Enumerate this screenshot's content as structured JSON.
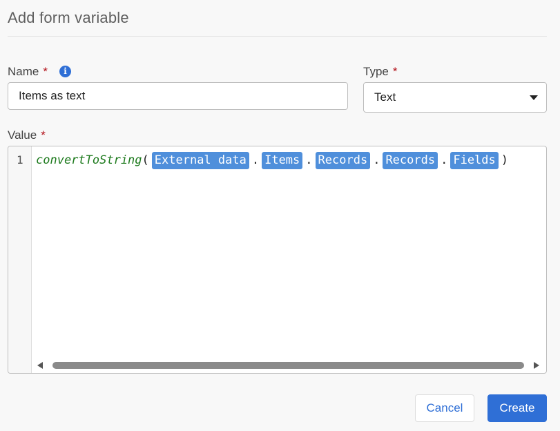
{
  "dialog": {
    "title": "Add form variable"
  },
  "name_field": {
    "label": "Name",
    "required_mark": "*",
    "value": "Items as text"
  },
  "type_field": {
    "label": "Type",
    "required_mark": "*",
    "selected": "Text"
  },
  "value_field": {
    "label": "Value",
    "required_mark": "*",
    "line_number": "1",
    "function": "convertToString",
    "open_paren": "(",
    "close_paren": ")",
    "separator": ".",
    "tokens": [
      "External data",
      "Items",
      "Records",
      "Records",
      "Fields"
    ]
  },
  "buttons": {
    "cancel": "Cancel",
    "create": "Create"
  },
  "colors": {
    "accent": "#2f6fd6",
    "token_chip": "#4f8fdb",
    "function": "#1d7a1d",
    "required": "#b3121b"
  }
}
